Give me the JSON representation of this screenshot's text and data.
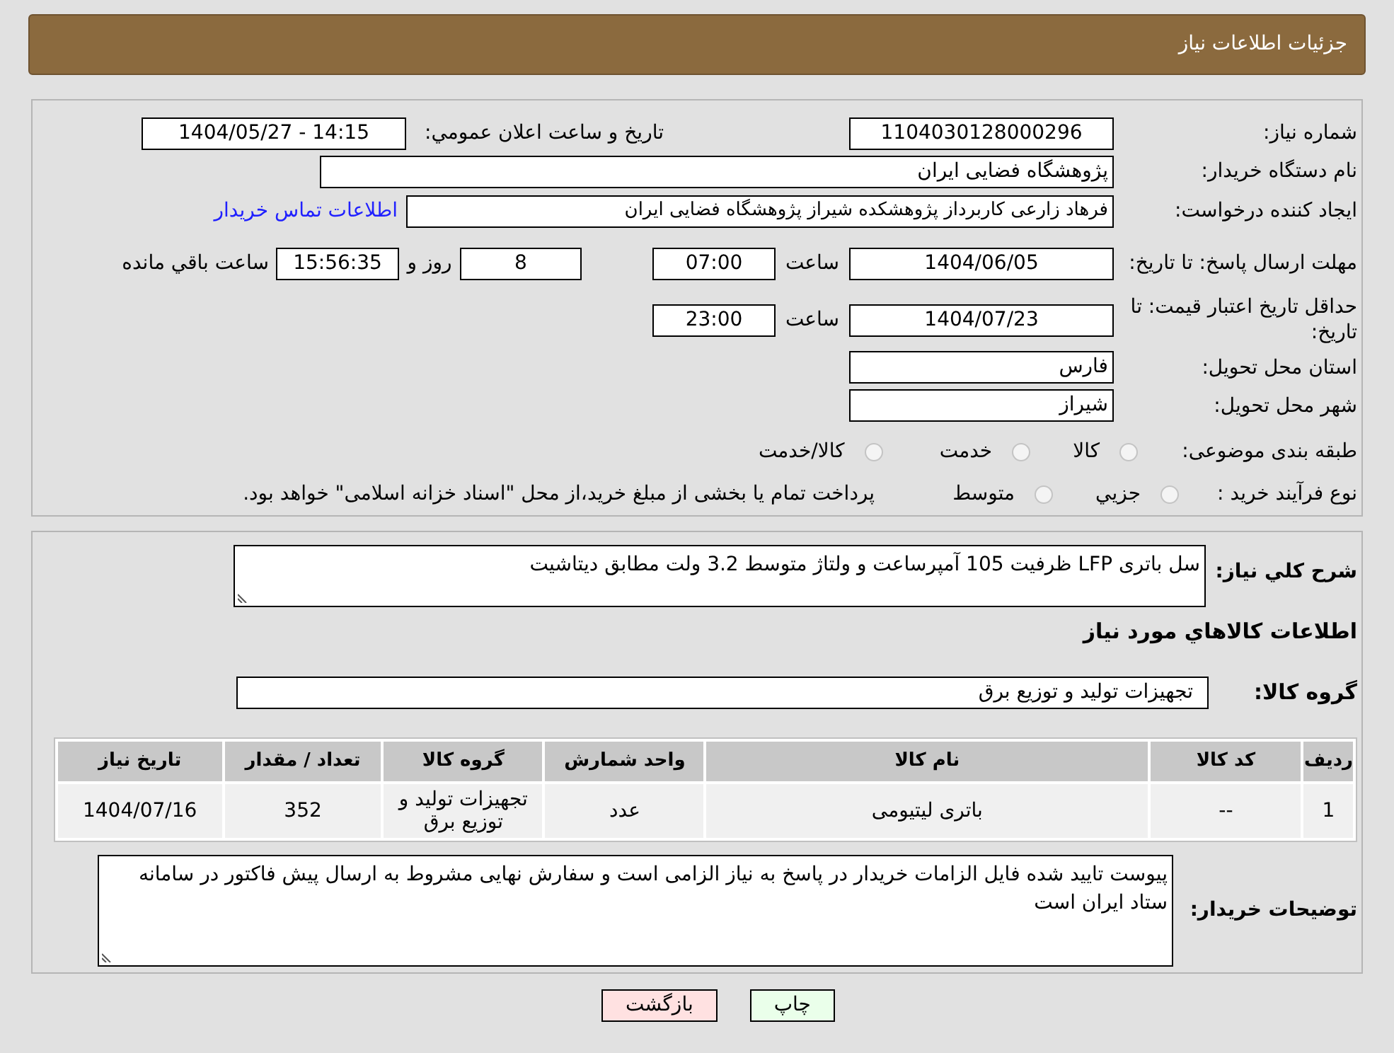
{
  "header": {
    "title": "جزئیات اطلاعات نیاز"
  },
  "need_number": {
    "label": "شماره نیاز:",
    "value": "1104030128000296"
  },
  "announce": {
    "label": "تاریخ و ساعت اعلان عمومي:",
    "value": "1404/05/27 - 14:15"
  },
  "buyer": {
    "label": "نام دستگاه خریدار:",
    "value": "پژوهشگاه فضایی ایران"
  },
  "requester": {
    "label": "ایجاد کننده درخواست:",
    "value": "فرهاد زارعی کاربرداز پژوهشکده شیراز پژوهشگاه فضایی ایران",
    "link": "اطلاعات تماس خریدار"
  },
  "deadline": {
    "label": "مهلت ارسال پاسخ: تا تاریخ:",
    "date": "1404/06/05",
    "time_label": "ساعت",
    "time": "07:00",
    "days": "8",
    "days_label": "روز و",
    "remaining": "15:56:35",
    "remaining_label": "ساعت باقي مانده"
  },
  "price_validity": {
    "label": "حداقل تاریخ اعتبار قیمت: تا تاریخ:",
    "date": "1404/07/23",
    "time_label": "ساعت",
    "time": "23:00"
  },
  "province": {
    "label": "استان محل تحویل:",
    "value": "فارس"
  },
  "city": {
    "label": "شهر محل تحویل:",
    "value": "شیراز"
  },
  "category": {
    "label": "طبقه بندی موضوعی:",
    "options": [
      {
        "label": "کالا",
        "selected": false
      },
      {
        "label": "خدمت",
        "selected": false
      },
      {
        "label": "کالا/خدمت",
        "selected": false
      }
    ]
  },
  "process": {
    "label": "نوع فرآیند خرید :",
    "options": [
      {
        "label": "جزيي",
        "selected": false
      },
      {
        "label": "متوسط",
        "selected": false
      }
    ],
    "note": "پرداخت تمام یا بخشی از مبلغ خرید،از محل \"اسناد خزانه اسلامی\" خواهد بود."
  },
  "description": {
    "label": "شرح كلي نیاز:",
    "value": "سل باتری LFP ظرفیت 105 آمپرساعت و ولتاژ متوسط 3.2 ولت مطابق دیتاشیت"
  },
  "goods_heading": "اطلاعات كالاهاي مورد نیاز",
  "goods_group": {
    "label": "گروه کالا:",
    "value": "تجهیزات تولید و توزیع برق"
  },
  "table": {
    "columns": [
      "ردیف",
      "کد کالا",
      "نام کالا",
      "واحد شمارش",
      "گروه کالا",
      "تعداد / مقدار",
      "تاریخ نیاز"
    ],
    "rows": [
      [
        "1",
        "--",
        "باتری لیتیومی",
        "عدد",
        "تجهیزات تولید و توزیع برق",
        "352",
        "1404/07/16"
      ]
    ]
  },
  "buyer_notes": {
    "label": "توضیحات خریدار:",
    "value": "پیوست تایید شده فایل الزامات خریدار در پاسخ به نیاز الزامی است و سفارش نهایی مشروط به ارسال پیش فاکتور در سامانه ستاد ایران است"
  },
  "buttons": [
    {
      "label": "چاپ",
      "kind": "print"
    },
    {
      "label": "بازگشت",
      "kind": "back"
    }
  ]
}
